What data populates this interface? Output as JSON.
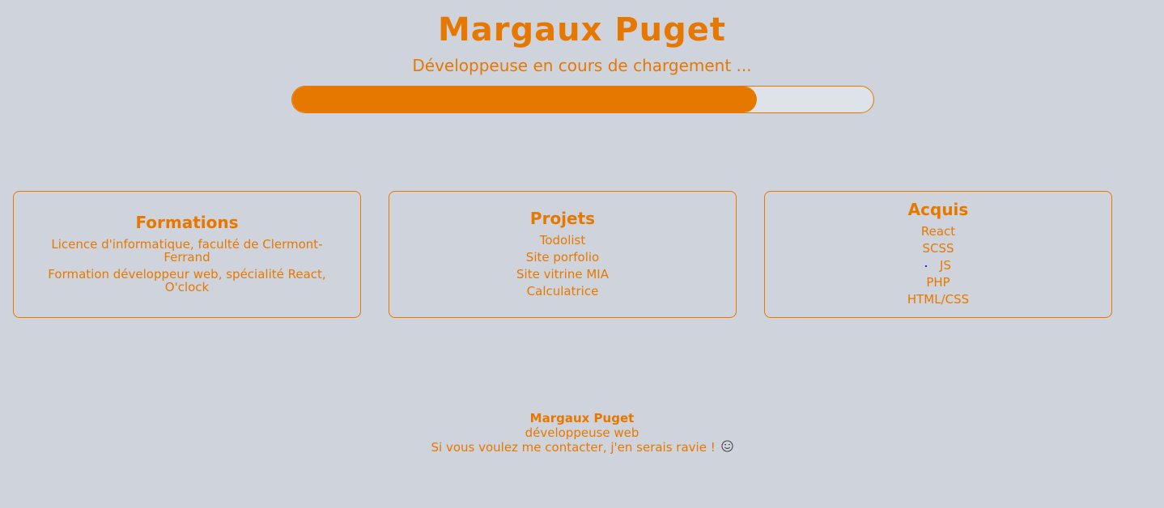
{
  "header": {
    "title": "Margaux Puget",
    "subtitle": "Développeuse en cours de chargement ...",
    "progress": 0.8
  },
  "cards": {
    "formations": {
      "title": "Formations",
      "items": [
        "Licence d'informatique, faculté de Clermont-Ferrand",
        "Formation développeur web, spécialité React, O'clock"
      ]
    },
    "projets": {
      "title": "Projets",
      "items": [
        "Todolist",
        "Site porfolio",
        "Site vitrine MIA",
        "Calculatrice"
      ]
    },
    "acquis": {
      "title": "Acquis",
      "items": [
        "React",
        "SCSS",
        "JS",
        "PHP",
        "HTML/CSS"
      ]
    }
  },
  "footer": {
    "name": "Margaux Puget",
    "role": "développeuse web",
    "contact": "Si vous voulez me contacter, j'en serais ravie !",
    "emoji_icon": "smiley-icon"
  },
  "colors": {
    "accent": "#e67800",
    "background": "#cfd4dc",
    "progress_track": "#dde3e8"
  }
}
